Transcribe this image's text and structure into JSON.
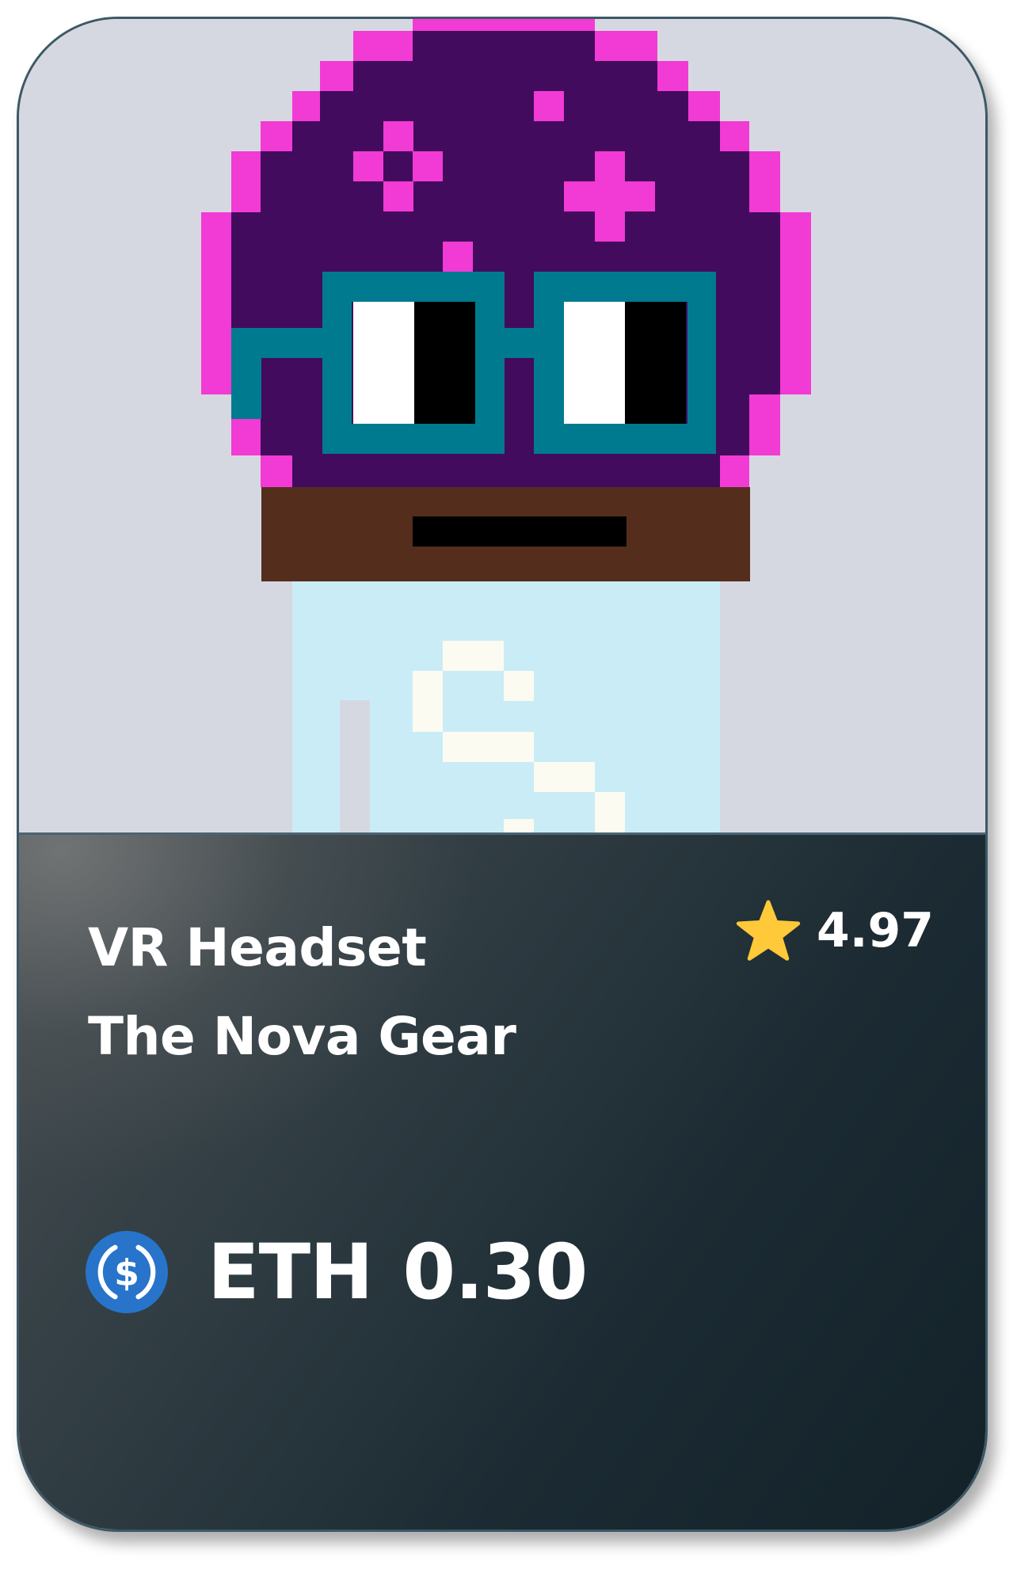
{
  "product": {
    "category": "VR Headset",
    "name": "The Nova Gear",
    "rating": "4.97",
    "currency": "ETH",
    "price": "0.30"
  },
  "icons": {
    "rating": "star-icon",
    "currency": "usd-coin-icon"
  },
  "colors": {
    "art_background": "#d6d8e1",
    "helmet": "#420b5e",
    "helmet_outline": "#f23ad4",
    "goggles": "#007a8f",
    "face": "#542d1d",
    "body": "#caecf6",
    "star": "#ffc93a",
    "coin": "#2774ca"
  }
}
